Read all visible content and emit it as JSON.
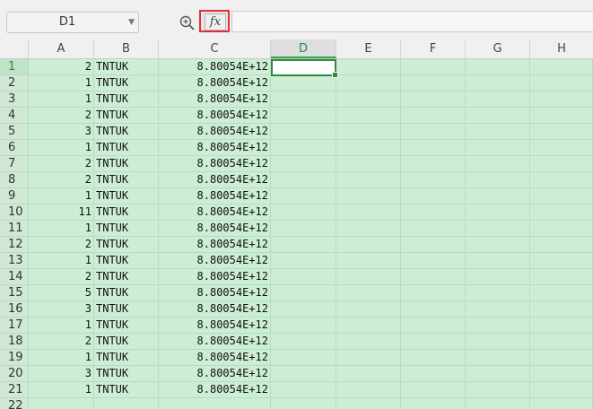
{
  "name_box": {
    "value": "D1"
  },
  "formula_bar": {
    "fx_label": "fx",
    "formula": ""
  },
  "columns": [
    "A",
    "B",
    "C",
    "D",
    "E",
    "F",
    "G",
    "H"
  ],
  "active_cell": {
    "column": "D",
    "row": 1
  },
  "rows": [
    {
      "num": "1",
      "a": "2",
      "b": "TNTUK",
      "c": "8.80054E+12"
    },
    {
      "num": "2",
      "a": "1",
      "b": "TNTUK",
      "c": "8.80054E+12"
    },
    {
      "num": "3",
      "a": "1",
      "b": "TNTUK",
      "c": "8.80054E+12"
    },
    {
      "num": "4",
      "a": "2",
      "b": "TNTUK",
      "c": "8.80054E+12"
    },
    {
      "num": "5",
      "a": "3",
      "b": "TNTUK",
      "c": "8.80054E+12"
    },
    {
      "num": "6",
      "a": "1",
      "b": "TNTUK",
      "c": "8.80054E+12"
    },
    {
      "num": "7",
      "a": "2",
      "b": "TNTUK",
      "c": "8.80054E+12"
    },
    {
      "num": "8",
      "a": "2",
      "b": "TNTUK",
      "c": "8.80054E+12"
    },
    {
      "num": "9",
      "a": "1",
      "b": "TNTUK",
      "c": "8.80054E+12"
    },
    {
      "num": "10",
      "a": "11",
      "b": "TNTUK",
      "c": "8.80054E+12"
    },
    {
      "num": "11",
      "a": "1",
      "b": "TNTUK",
      "c": "8.80054E+12"
    },
    {
      "num": "12",
      "a": "2",
      "b": "TNTUK",
      "c": "8.80054E+12"
    },
    {
      "num": "13",
      "a": "1",
      "b": "TNTUK",
      "c": "8.80054E+12"
    },
    {
      "num": "14",
      "a": "2",
      "b": "TNTUK",
      "c": "8.80054E+12"
    },
    {
      "num": "15",
      "a": "5",
      "b": "TNTUK",
      "c": "8.80054E+12"
    },
    {
      "num": "16",
      "a": "3",
      "b": "TNTUK",
      "c": "8.80054E+12"
    },
    {
      "num": "17",
      "a": "1",
      "b": "TNTUK",
      "c": "8.80054E+12"
    },
    {
      "num": "18",
      "a": "2",
      "b": "TNTUK",
      "c": "8.80054E+12"
    },
    {
      "num": "19",
      "a": "1",
      "b": "TNTUK",
      "c": "8.80054E+12"
    },
    {
      "num": "20",
      "a": "3",
      "b": "TNTUK",
      "c": "8.80054E+12"
    },
    {
      "num": "21",
      "a": "1",
      "b": "TNTUK",
      "c": "8.80054E+12"
    },
    {
      "num": "22",
      "a": "",
      "b": "",
      "c": ""
    }
  ],
  "colors": {
    "grid_background": "#cceed5",
    "selection": "#2e8b3c",
    "fx_highlight": "#e0303a"
  }
}
